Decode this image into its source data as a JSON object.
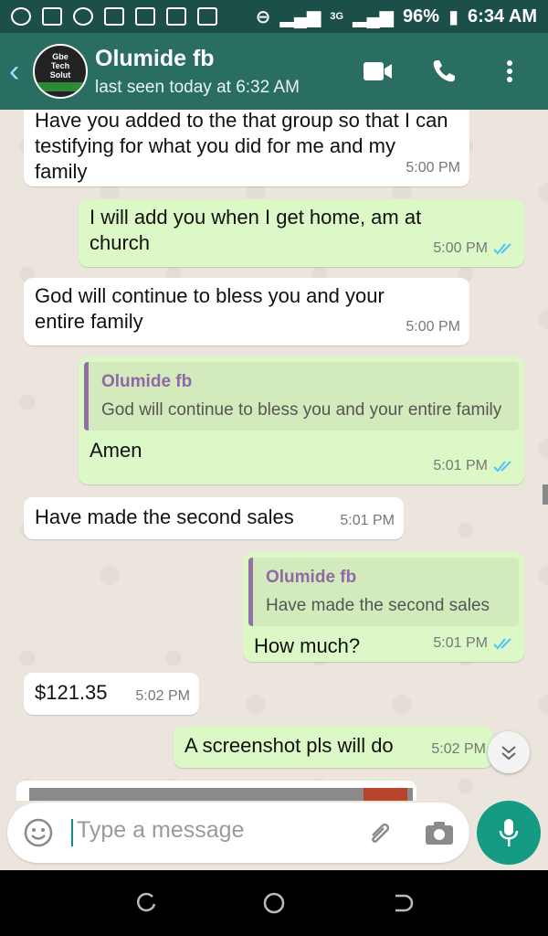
{
  "status_bar": {
    "network_label": "3G",
    "battery": "96%",
    "time": "6:34 AM"
  },
  "header": {
    "avatar_lines": [
      "Gbe",
      "Tech",
      "Solut"
    ],
    "contact_name": "Olumide fb",
    "contact_status": "last seen today at 6:32 AM",
    "icons": [
      "back-icon",
      "video-call-icon",
      "voice-call-icon",
      "menu-icon"
    ]
  },
  "messages": [
    {
      "dir": "in",
      "text": "Have you added to the that group so that I can testifying for what you did for me and my family",
      "time": "5:00 PM"
    },
    {
      "dir": "out",
      "text": "I will add you when I get home, am at church",
      "time": "5:00 PM"
    },
    {
      "dir": "in",
      "text": "God will continue to bless you and your entire family",
      "time": "5:00 PM"
    },
    {
      "dir": "out",
      "quote_name": "Olumide fb",
      "quote_text": "God will continue to bless you and your entire family",
      "text": "Amen",
      "time": "5:01 PM"
    },
    {
      "dir": "in",
      "text": "Have made the second sales",
      "time": "5:01 PM"
    },
    {
      "dir": "out",
      "quote_name": "Olumide fb",
      "quote_text": "Have made the second sales",
      "text": "How much?",
      "time": "5:01 PM"
    },
    {
      "dir": "in",
      "text": "$121.35",
      "time": "5:02 PM"
    },
    {
      "dir": "out",
      "text": "A screenshot pls will do",
      "time": "5:02 PM"
    }
  ],
  "composer": {
    "placeholder": "Type a message"
  },
  "colors": {
    "header": "#2a6e62",
    "status_bar": "#1c4f47",
    "outgoing": "#dcf8c6",
    "incoming": "#ffffff",
    "accent": "#159a84",
    "ticks": "#4fc3f7"
  }
}
